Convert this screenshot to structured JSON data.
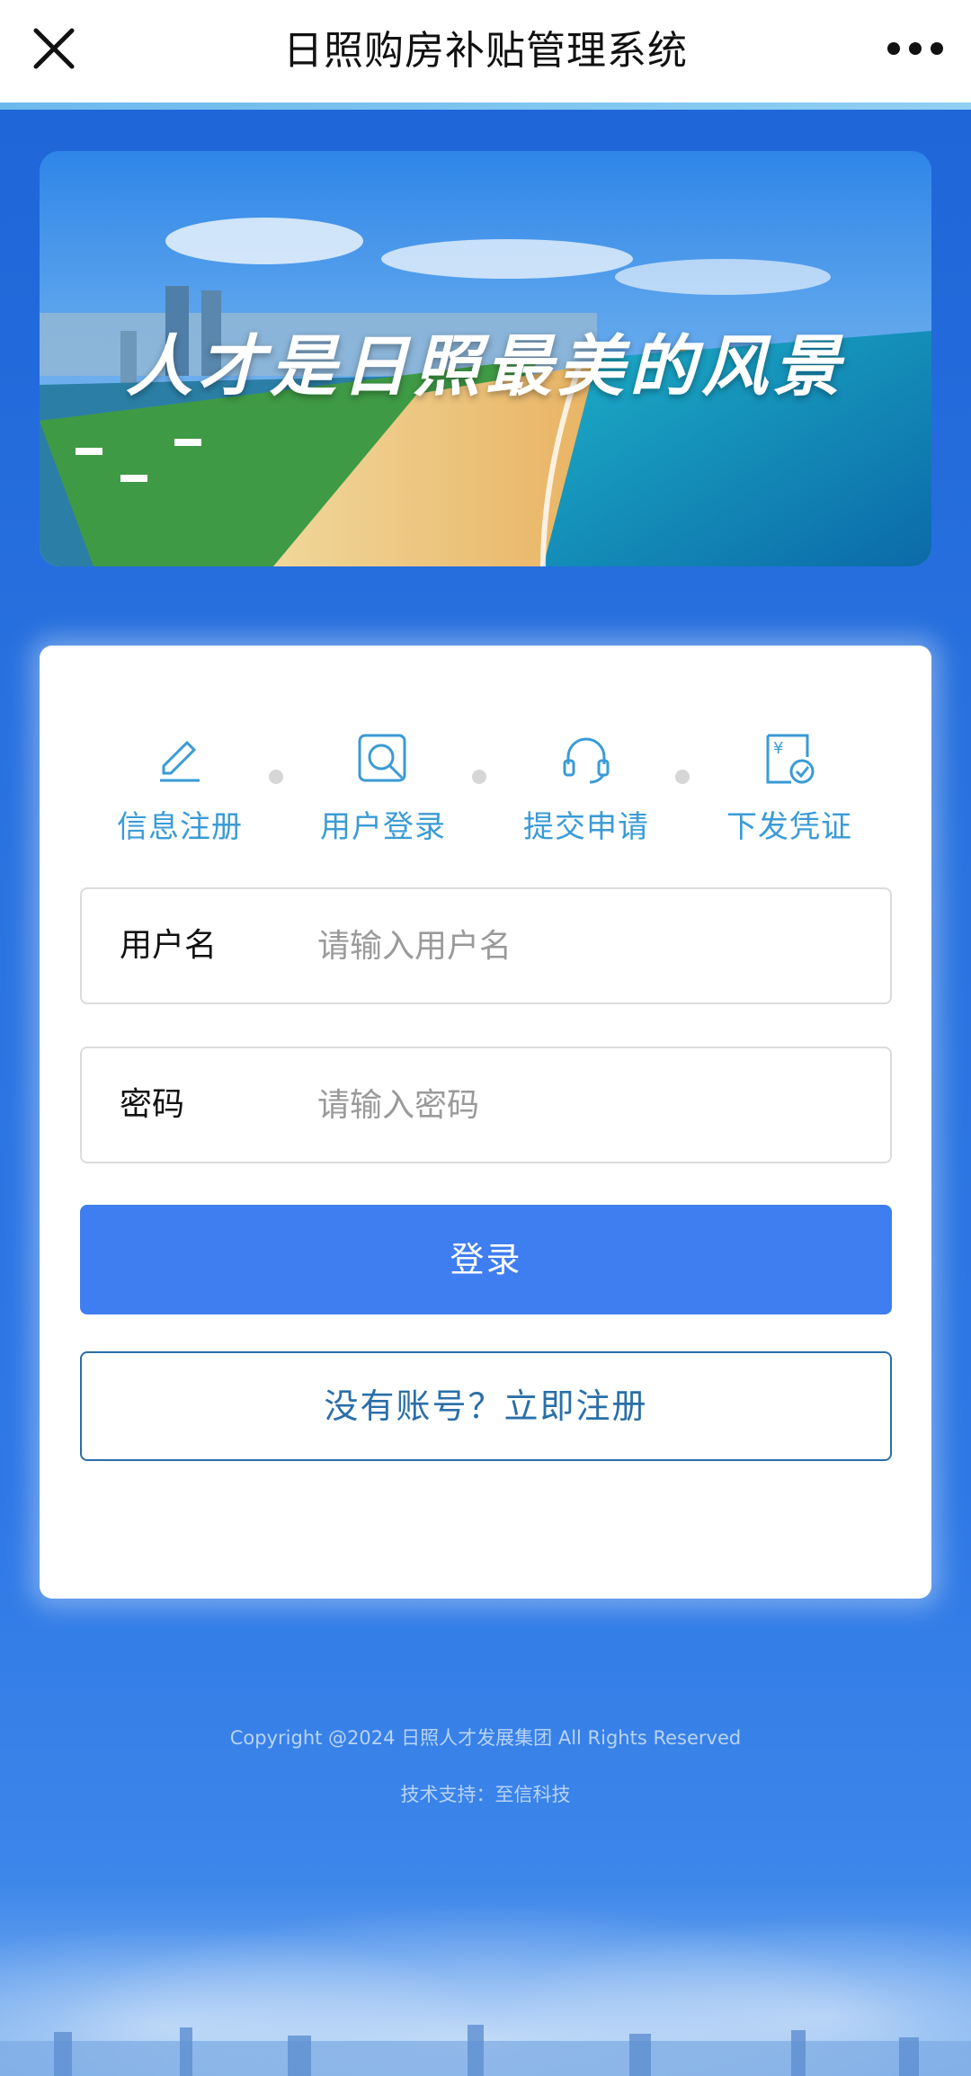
{
  "header": {
    "title": "日照购房补贴管理系统",
    "close_icon": "close-icon",
    "more_icon": "more-icon"
  },
  "banner": {
    "slogan": "人才是日照最美的风景"
  },
  "steps": [
    {
      "label": "信息注册",
      "icon": "pencil-icon"
    },
    {
      "label": "用户登录",
      "icon": "search-icon"
    },
    {
      "label": "提交申请",
      "icon": "headset-icon"
    },
    {
      "label": "下发凭证",
      "icon": "certificate-icon"
    }
  ],
  "form": {
    "username_label": "用户名",
    "username_placeholder": "请输入用户名",
    "password_label": "密码",
    "password_placeholder": "请输入密码",
    "login_label": "登录",
    "register_label": "没有账号？立即注册"
  },
  "footer": {
    "copyright": "Copyright @2024 日照人才发展集团 All Rights Reserved",
    "support": "技术支持：至信科技"
  },
  "colors": {
    "primary": "#3f7ef0",
    "step_accent": "#3a9bd6",
    "register_outline": "#2a6fa8",
    "background_blue": "#2a74e0"
  }
}
